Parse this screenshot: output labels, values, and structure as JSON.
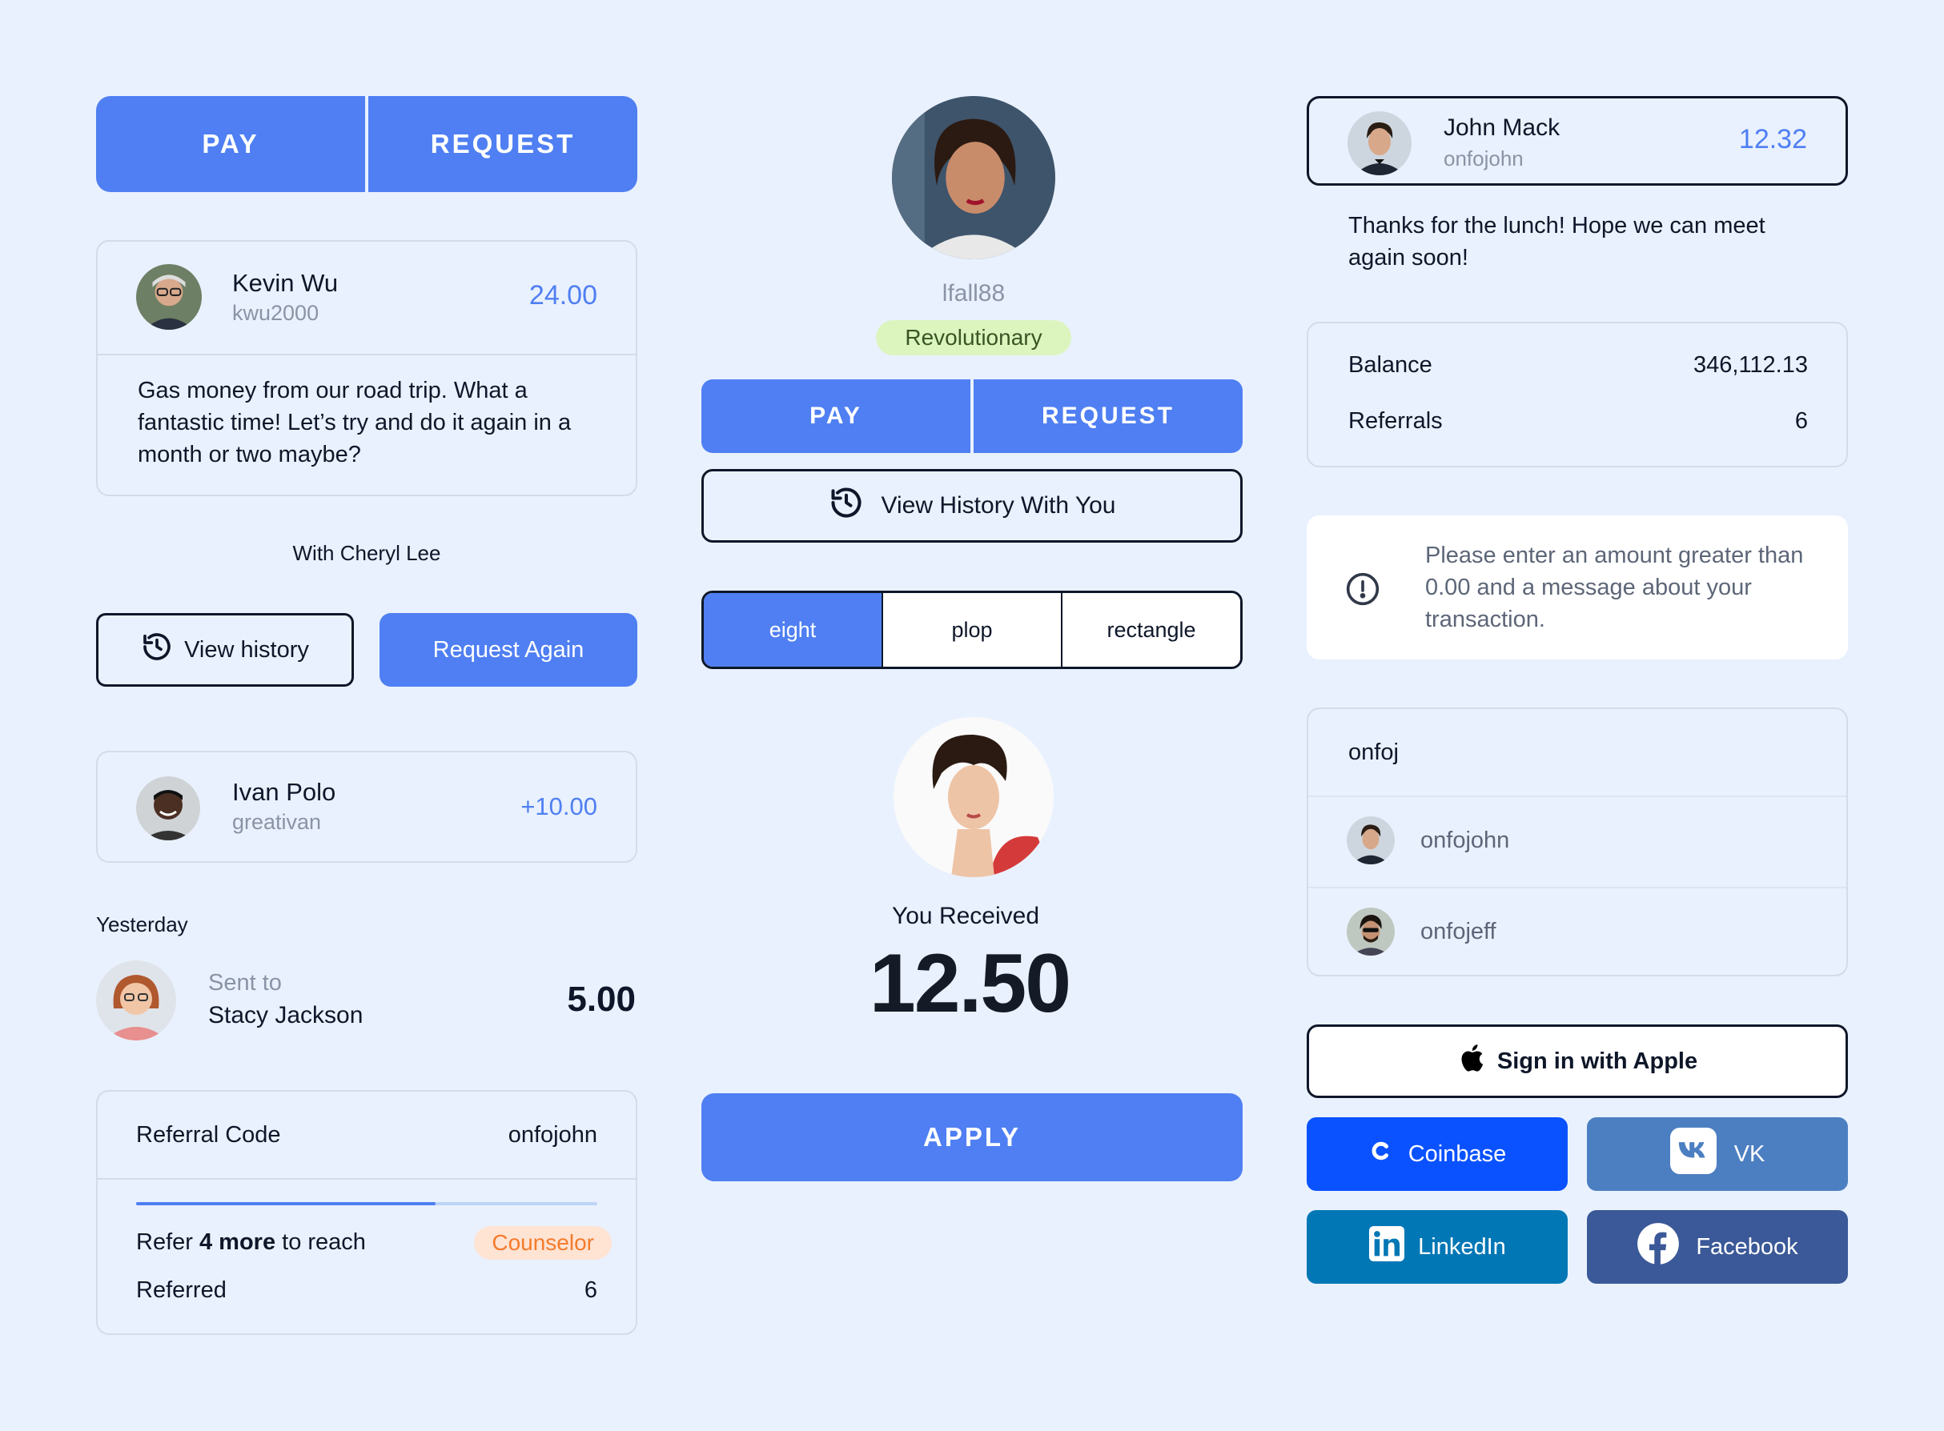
{
  "colors": {
    "background": "#e9f1fe",
    "accent": "#4f7ff2",
    "coinbase": "#0a52ff",
    "vk": "#4c7fc1",
    "linkedin": "#0277b5",
    "facebook": "#3b5998",
    "tag_green": "#dcf5bf",
    "tag_orange": "#ffe3d3"
  },
  "left": {
    "pay_label": "PAY",
    "request_label": "REQUEST",
    "kevin": {
      "name": "Kevin Wu",
      "handle": "kwu2000",
      "amount": "24.00",
      "message": "Gas money from our road trip. What a fantastic time! Let’s try and do it again in a month or two maybe?"
    },
    "with_label": "With Cheryl Lee",
    "view_history": "View history",
    "request_again": "Request Again",
    "ivan": {
      "name": "Ivan Polo",
      "handle": "greativan",
      "amount": "+10.00"
    },
    "yesterday": "Yesterday",
    "sent": {
      "label": "Sent to",
      "name": "Stacy Jackson",
      "amount": "5.00"
    },
    "referral": {
      "label": "Referral Code",
      "code": "onfojohn",
      "progress": 0.65,
      "refer_pre": "Refer ",
      "refer_count": "4 more",
      "refer_post": " to reach",
      "tier": "Counselor",
      "referred_label": "Referred",
      "referred_value": "6"
    }
  },
  "middle": {
    "username": "lfall88",
    "tag": "Revolutionary",
    "pay_label": "PAY",
    "request_label": "REQUEST",
    "view_history": "View History With You",
    "segments": [
      "eight",
      "plop",
      "rectangle"
    ],
    "received_label": "You Received",
    "received_amount": "12.50",
    "apply_label": "APPLY"
  },
  "right": {
    "john": {
      "name": "John Mack",
      "handle": "onfojohn",
      "amount": "12.32"
    },
    "thanks": "Thanks for the lunch! Hope we can meet again soon!",
    "balance_label": "Balance",
    "balance_value": "346,112.13",
    "referrals_label": "Referrals",
    "referrals_value": "6",
    "alert_icon": "alert-circle-icon",
    "alert": "Please enter an amount greater than 0.00 and a message about your transaction.",
    "search_value": "onfoj",
    "results": [
      "onfojohn",
      "onfojeff"
    ],
    "apple": "Sign in with Apple",
    "coinbase": "Coinbase",
    "vk": "VK",
    "linkedin": "LinkedIn",
    "facebook": "Facebook"
  }
}
